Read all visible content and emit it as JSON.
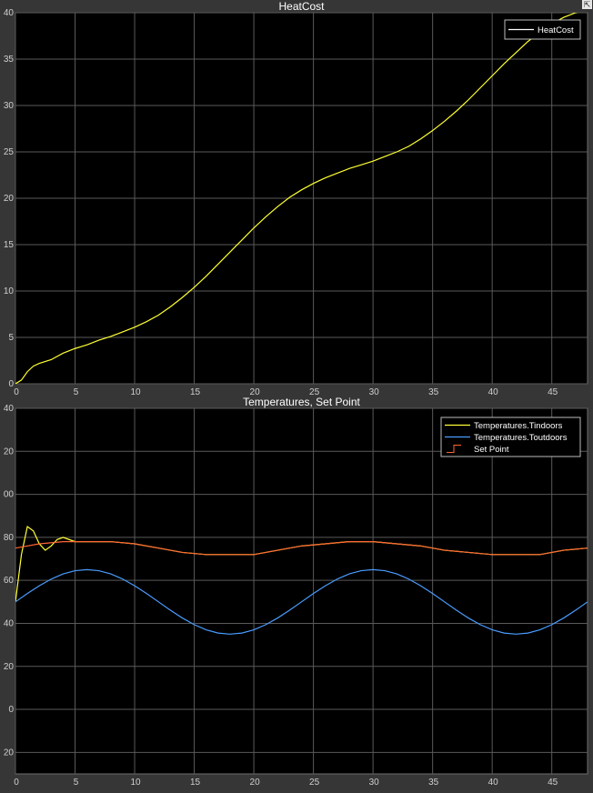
{
  "chart_data": [
    {
      "type": "line",
      "title": "HeatCost",
      "xlabel": "",
      "ylabel": "",
      "xlim": [
        0,
        48
      ],
      "ylim": [
        0,
        40
      ],
      "xticks": [
        0,
        5,
        10,
        15,
        20,
        25,
        30,
        35,
        40,
        45
      ],
      "yticks": [
        0,
        5,
        10,
        15,
        20,
        25,
        30,
        35,
        40
      ],
      "ytick_labels": [
        "0",
        "5",
        "10",
        "15",
        "20",
        "25",
        "30",
        "35",
        "40"
      ],
      "grid": true,
      "legend_position": "top-right",
      "series": [
        {
          "name": "HeatCost",
          "color": "#ffff33",
          "x": [
            0,
            0.5,
            1,
            1.5,
            2,
            3,
            4,
            5,
            6,
            7,
            8,
            9,
            10,
            11,
            12,
            13,
            14,
            15,
            16,
            17,
            18,
            19,
            20,
            21,
            22,
            23,
            24,
            25,
            26,
            27,
            28,
            29,
            30,
            31,
            32,
            33,
            34,
            35,
            36,
            37,
            38,
            39,
            40,
            41,
            42,
            43,
            44,
            45,
            46,
            47,
            48
          ],
          "y": [
            0,
            0.4,
            1.3,
            1.9,
            2.2,
            2.6,
            3.3,
            3.8,
            4.2,
            4.7,
            5.1,
            5.6,
            6.1,
            6.7,
            7.4,
            8.3,
            9.3,
            10.4,
            11.6,
            12.9,
            14.2,
            15.5,
            16.8,
            18.0,
            19.1,
            20.1,
            20.9,
            21.6,
            22.2,
            22.7,
            23.2,
            23.6,
            24.0,
            24.5,
            25.0,
            25.6,
            26.4,
            27.3,
            28.3,
            29.4,
            30.6,
            31.9,
            33.2,
            34.5,
            35.7,
            36.9,
            37.9,
            38.8,
            39.5,
            40.0,
            40.3
          ]
        }
      ],
      "legend_entries": [
        "HeatCost"
      ]
    },
    {
      "type": "line",
      "title": "Temperatures, Set Point",
      "xlabel": "",
      "ylabel": "",
      "xlim": [
        0,
        48
      ],
      "ylim": [
        -30,
        140
      ],
      "xticks": [
        0,
        5,
        10,
        15,
        20,
        25,
        30,
        35,
        40,
        45
      ],
      "yticks": [
        -20,
        0,
        20,
        40,
        60,
        80,
        100,
        120,
        140
      ],
      "ytick_labels": [
        "20",
        "0",
        "20",
        "40",
        "60",
        "80",
        "00",
        "20",
        "40"
      ],
      "grid": true,
      "legend_position": "top-right",
      "series": [
        {
          "name": "Temperatures.Tindoors",
          "color": "#ffff33",
          "x": [
            0,
            0.5,
            1,
            1.5,
            2,
            2.5,
            3,
            3.5,
            4,
            4.5,
            5,
            6,
            8,
            10,
            12,
            14,
            16,
            18,
            20,
            22,
            24,
            26,
            28,
            30,
            32,
            34,
            36,
            38,
            40,
            42,
            44,
            46,
            48
          ],
          "y": [
            50,
            72,
            85,
            83,
            77,
            74,
            76,
            79,
            80,
            79,
            78,
            78,
            78,
            77,
            75,
            73,
            72,
            72,
            72,
            74,
            76,
            77,
            78,
            78,
            77,
            76,
            74,
            73,
            72,
            72,
            72,
            74,
            75
          ]
        },
        {
          "name": "Temperatures.Toutdoors",
          "color": "#4a9cff",
          "x": [
            0,
            1,
            2,
            3,
            4,
            5,
            6,
            7,
            8,
            9,
            10,
            11,
            12,
            13,
            14,
            15,
            16,
            17,
            18,
            19,
            20,
            21,
            22,
            23,
            24,
            25,
            26,
            27,
            28,
            29,
            30,
            31,
            32,
            33,
            34,
            35,
            36,
            37,
            38,
            39,
            40,
            41,
            42,
            43,
            44,
            45,
            46,
            47,
            48
          ],
          "y": [
            50,
            53.9,
            57.5,
            60.6,
            63,
            64.5,
            65,
            64.5,
            63,
            60.6,
            57.5,
            53.9,
            50,
            46.1,
            42.5,
            39.4,
            37,
            35.5,
            35,
            35.5,
            37,
            39.4,
            42.5,
            46.1,
            50,
            53.9,
            57.5,
            60.6,
            63,
            64.5,
            65,
            64.5,
            63,
            60.6,
            57.5,
            53.9,
            50,
            46.1,
            42.5,
            39.4,
            37,
            35.5,
            35,
            35.5,
            37,
            39.4,
            42.5,
            46.1,
            50
          ]
        },
        {
          "name": "Set Point",
          "color": "#ff6633",
          "x": [
            0,
            2,
            4,
            6,
            8,
            10,
            12,
            14,
            16,
            18,
            20,
            22,
            24,
            26,
            28,
            30,
            32,
            34,
            36,
            38,
            40,
            42,
            44,
            46,
            48
          ],
          "y": [
            75,
            77,
            78,
            78,
            78,
            77,
            75,
            73,
            72,
            72,
            72,
            74,
            76,
            77,
            78,
            78,
            77,
            76,
            74,
            73,
            72,
            72,
            72,
            74,
            75
          ]
        }
      ],
      "legend_entries": [
        "Temperatures.Tindoors",
        "Temperatures.Toutdoors",
        "Set Point"
      ]
    }
  ],
  "ui": {
    "background": "#363636",
    "plot_background": "#000000",
    "expand_icon": "expand-icon"
  }
}
